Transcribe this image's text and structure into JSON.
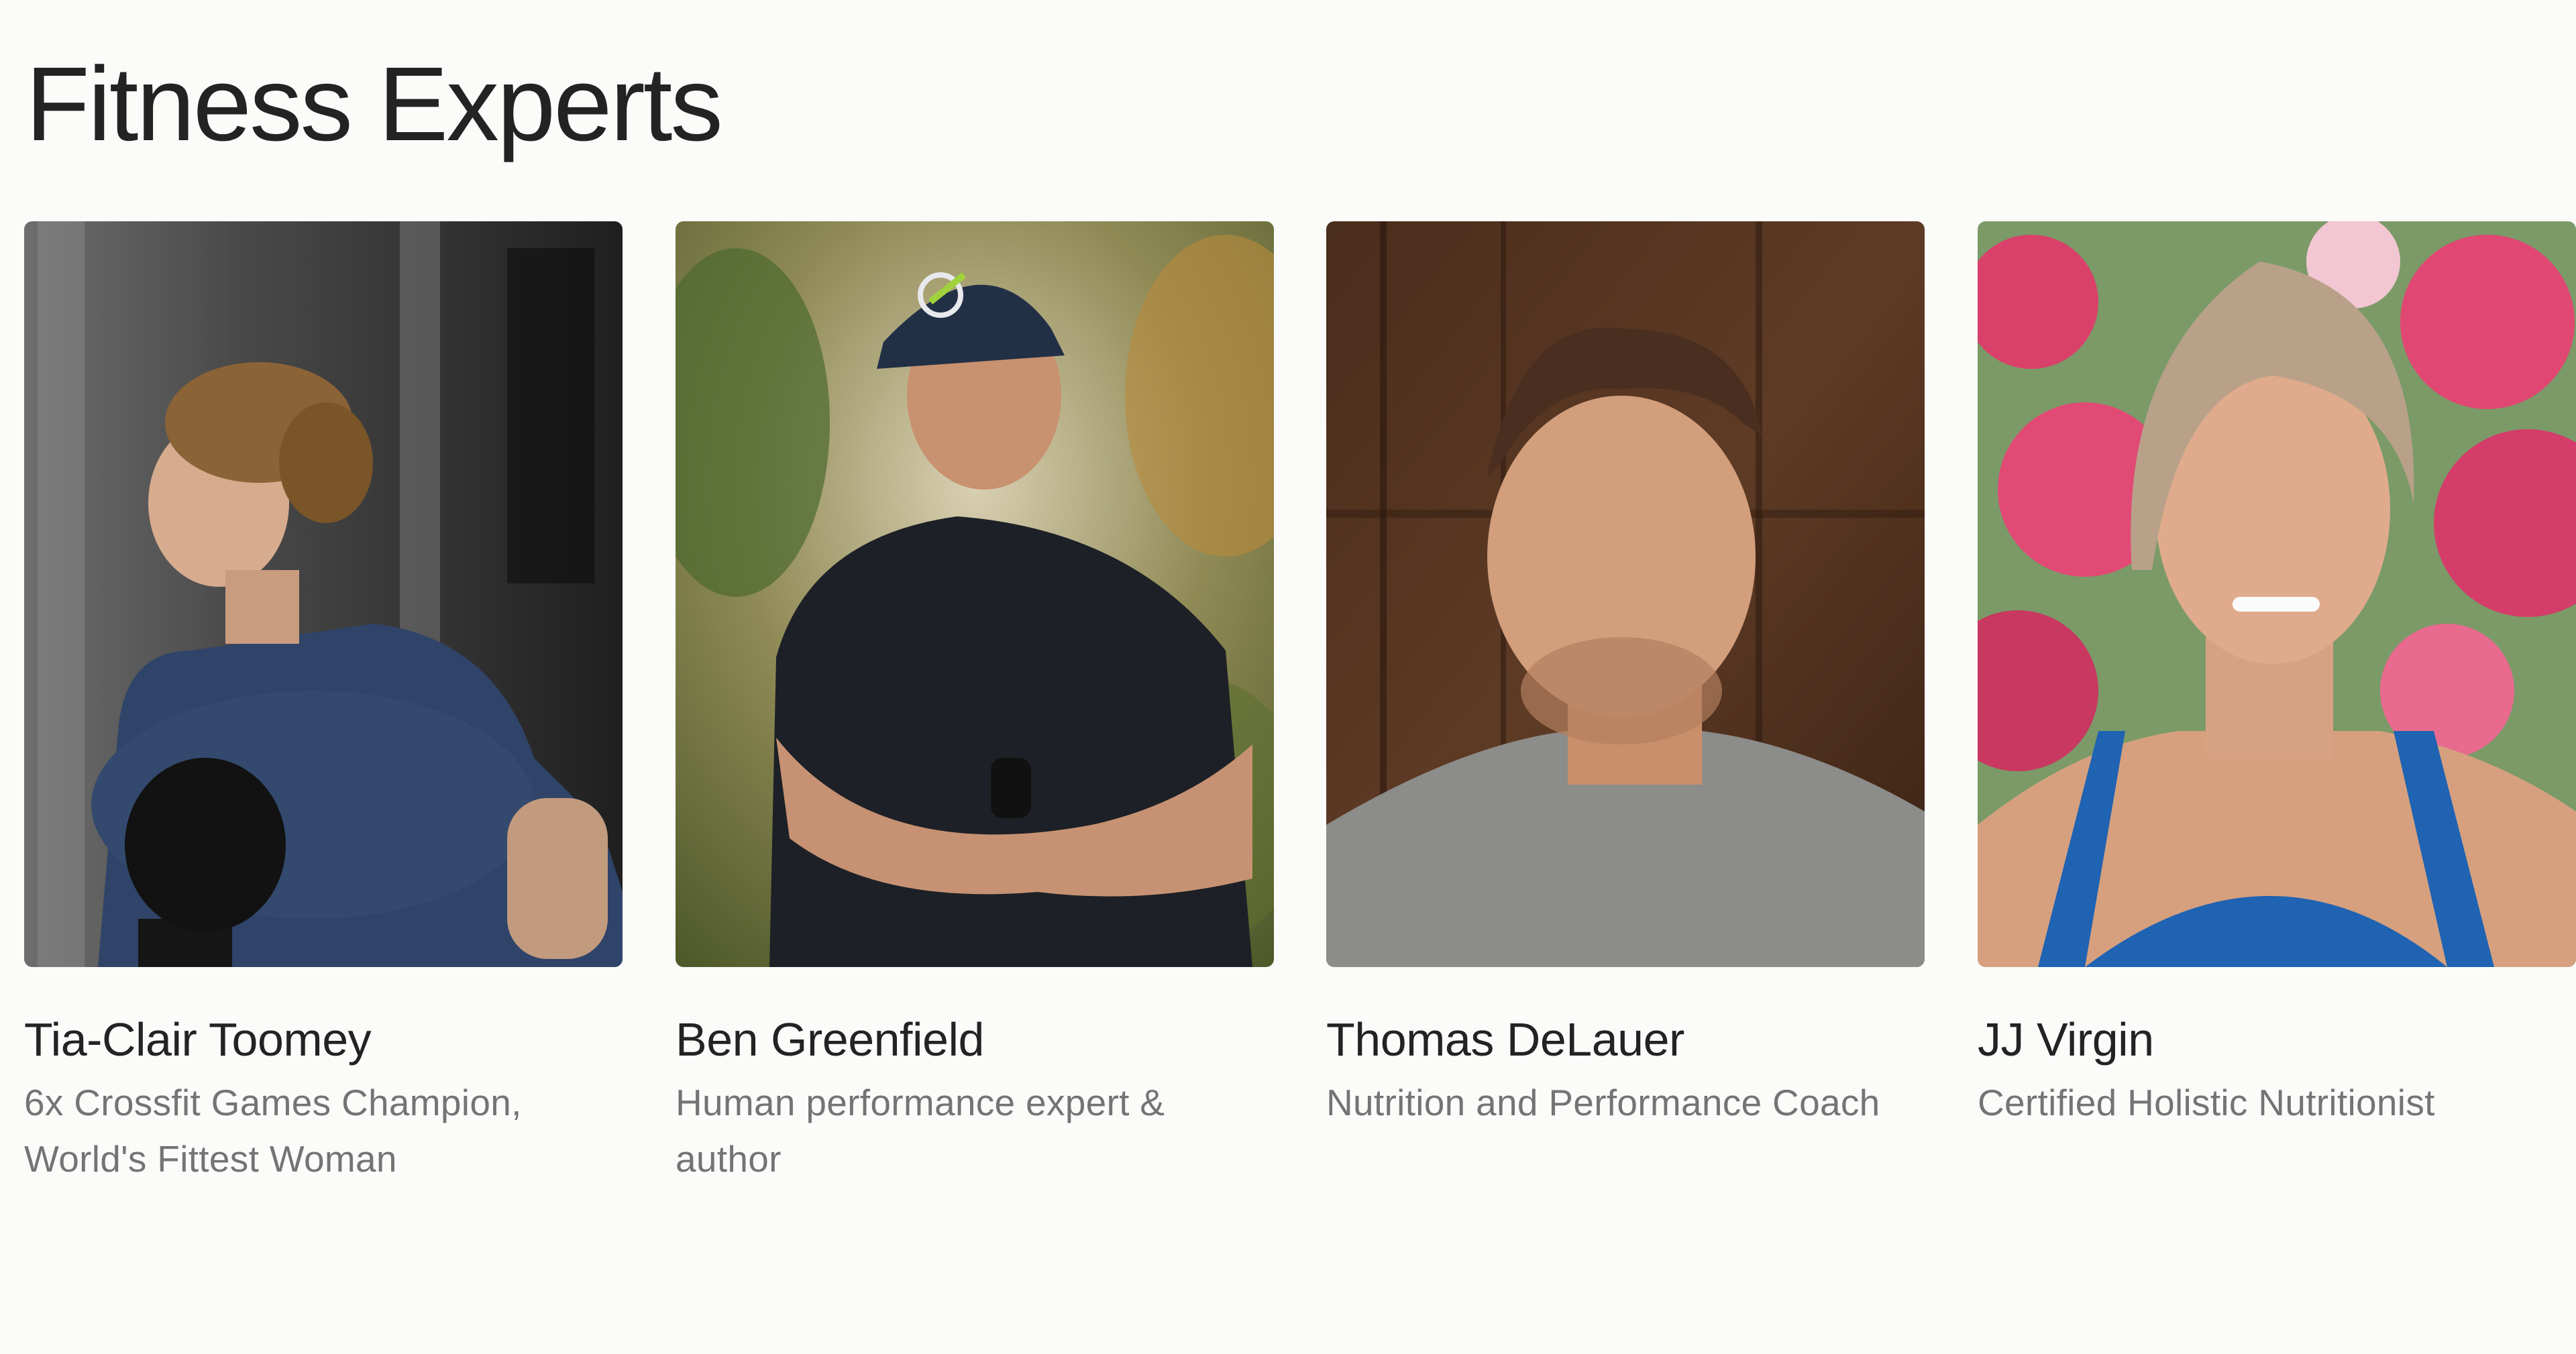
{
  "page": {
    "title": "Fitness Experts"
  },
  "colors": {
    "background": "#fbfbf9",
    "title_text": "#232323",
    "subtitle_text": "#747474"
  },
  "experts": [
    {
      "name": "Tia-Clair Toomey",
      "role": "6x Crossfit Games Champion, World's Fittest Woman",
      "photo_icon": "portrait-photo"
    },
    {
      "name": "Ben Greenfield",
      "role": "Human performance expert & author",
      "photo_icon": "portrait-photo"
    },
    {
      "name": "Thomas DeLauer",
      "role": "Nutrition and Performance Coach",
      "photo_icon": "portrait-photo"
    },
    {
      "name": "JJ Virgin",
      "role": "Certified Holistic Nutritionist",
      "photo_icon": "portrait-photo"
    }
  ]
}
